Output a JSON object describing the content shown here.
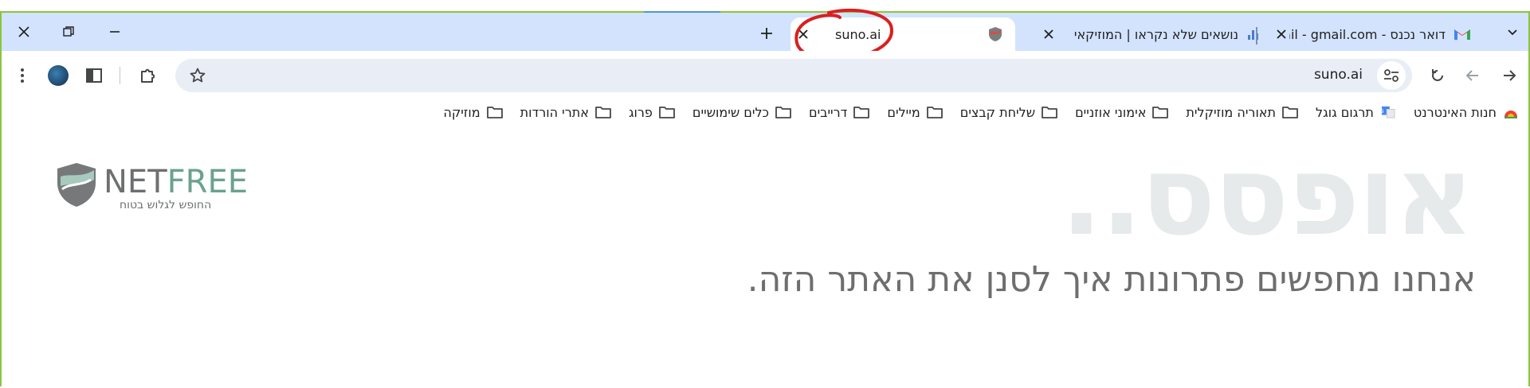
{
  "window": {
    "close_label": "close",
    "restore_label": "restore",
    "minimize_label": "minimize"
  },
  "tabs": [
    {
      "title": "suno.ai",
      "active": true
    },
    {
      "title": "נושאים שלא נקראו | המוזיקאי",
      "active": false
    },
    {
      "title": "דואר נכנס - Gmail - gmail.com@",
      "active": false
    }
  ],
  "toolbar": {
    "url": "suno.ai"
  },
  "bookmarks": [
    {
      "label": "חנות האינטרנט",
      "icon": "webstore-icon"
    },
    {
      "label": "תרגום גוגל",
      "icon": "google-translate-icon"
    },
    {
      "label": "תאוריה מוזיקלית",
      "icon": "folder-icon"
    },
    {
      "label": "אימוני אוזניים",
      "icon": "folder-icon"
    },
    {
      "label": "שליחת קבצים",
      "icon": "folder-icon"
    },
    {
      "label": "מיילים",
      "icon": "folder-icon"
    },
    {
      "label": "דרייבים",
      "icon": "folder-icon"
    },
    {
      "label": "כלים שימושיים",
      "icon": "folder-icon"
    },
    {
      "label": "פרוג",
      "icon": "folder-icon"
    },
    {
      "label": "אתרי הורדות",
      "icon": "folder-icon"
    },
    {
      "label": "מוזיקה",
      "icon": "folder-icon"
    }
  ],
  "page": {
    "heading": "אופסס..",
    "message": "אנחנו מחפשים פתרונות איך לסנן את האתר הזה."
  },
  "logo": {
    "net": "NET",
    "free": "FREE",
    "tagline": "החופש לגלוש בטוח"
  },
  "colors": {
    "tabstrip": "#d3e3fd",
    "frame": "#8ac53f",
    "annotation": "#d9201f",
    "logo_green": "#6aa28e",
    "logo_gray": "#6d6f70"
  }
}
